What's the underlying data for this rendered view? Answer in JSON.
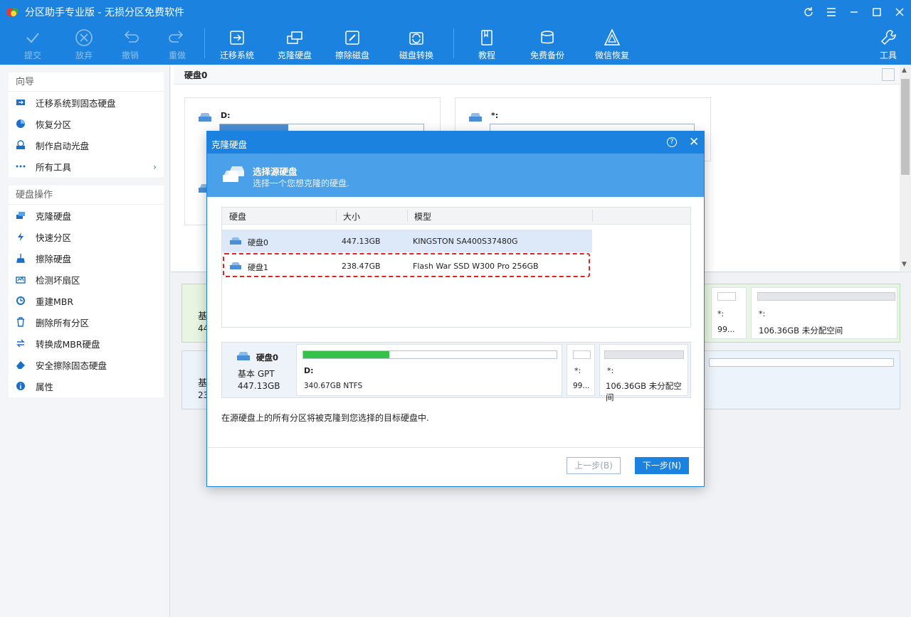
{
  "window": {
    "title": "分区助手专业版 - 无损分区免费软件"
  },
  "toolbar": {
    "commit": "提交",
    "discard": "放弃",
    "undo": "撤销",
    "redo": "重做",
    "migrate": "迁移系统",
    "clone": "克隆硬盘",
    "wipe": "擦除磁盘",
    "convert": "磁盘转换",
    "tutorial": "教程",
    "backup": "免费备份",
    "recover": "微信恢复",
    "tools": "工具"
  },
  "sidebar": {
    "wizard_title": "向导",
    "wizard_items": [
      "迁移系统到固态硬盘",
      "恢复分区",
      "制作启动光盘",
      "所有工具"
    ],
    "ops_title": "硬盘操作",
    "ops_items": [
      "克隆硬盘",
      "快速分区",
      "擦除硬盘",
      "检测坏扇区",
      "重建MBR",
      "删除所有分区",
      "转换成MBR硬盘",
      "安全擦除固态硬盘",
      "属性"
    ]
  },
  "main": {
    "header": "硬盘0",
    "cards": [
      {
        "label": "D:"
      },
      {
        "label": "*:"
      }
    ],
    "bg_rows": [
      {
        "c1": "基",
        "c2": "44",
        "p1": "*:",
        "p1v": "99...",
        "p2": "*:",
        "p2v": "106.36GB 未分配空间"
      },
      {
        "c1": "基",
        "c2": "23"
      }
    ]
  },
  "dialog": {
    "title": "克隆硬盘",
    "help": "?",
    "close": "✕",
    "heading": "选择源硬盘",
    "subheading": "选择一个您想克隆的硬盘.",
    "columns": [
      "硬盘",
      "大小",
      "模型"
    ],
    "rows": [
      {
        "disk": "硬盘0",
        "size": "447.13GB",
        "model": "KINGSTON SA400S37480G"
      },
      {
        "disk": "硬盘1",
        "size": "238.47GB",
        "model": "Flash War SSD W300 Pro 256GB"
      }
    ],
    "source": {
      "name": "硬盘0",
      "type": "基本 GPT",
      "size": "447.13GB",
      "part1_label": "D:",
      "part1_info": "340.67GB NTFS",
      "part1_fill": 0.34,
      "part2_label": "*:",
      "part2_info": "99...",
      "part3_label": "*:",
      "part3_info": "106.36GB 未分配空间"
    },
    "note": "在源硬盘上的所有分区将被克隆到您选择的目标硬盘中.",
    "prev": "上一步(B)",
    "next": "下一步(N)"
  },
  "colors": {
    "accent": "#1b82e0",
    "highlight": "#e52020",
    "bar": "#35c248"
  }
}
